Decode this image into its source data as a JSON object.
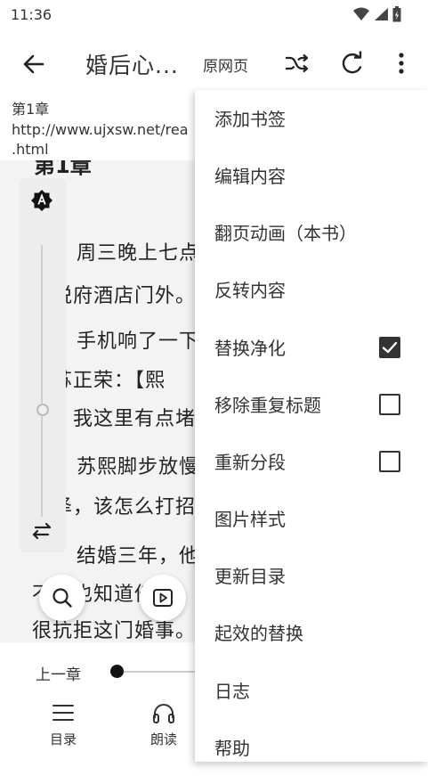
{
  "status": {
    "time": "11:36"
  },
  "appbar": {
    "title": "婚后心...",
    "origin_label": "原网页"
  },
  "info": {
    "chapter": "第1章",
    "url_line1": "http://www.ujxsw.net/rea",
    "url_line2": ".html"
  },
  "content": {
    "heading": "第1章",
    "lines": [
      "周三晚上七点",
      "天悦府酒店门外。",
      "手机响了一下",
      "是苏正荣：【熙",
      "爸，我这里有点堵",
      "苏熙脚步放慢",
      "久泽，该怎么打招",
      "结婚三年，他",
      "不想也知道他",
      "很抗拒这门婚事。"
    ]
  },
  "bottom": {
    "prev_chapter": "上一章",
    "nav": [
      "目录",
      "朗读"
    ]
  },
  "menu": {
    "items": [
      {
        "label": "添加书签"
      },
      {
        "label": "编辑内容"
      },
      {
        "label": "翻页动画（本书）"
      },
      {
        "label": "反转内容"
      },
      {
        "label": "替换净化",
        "checked": true
      },
      {
        "label": "移除重复标题",
        "checked": false
      },
      {
        "label": "重新分段",
        "checked": false
      },
      {
        "label": "图片样式"
      },
      {
        "label": "更新目录"
      },
      {
        "label": "起效的替换"
      },
      {
        "label": "日志"
      },
      {
        "label": "帮助"
      }
    ]
  }
}
